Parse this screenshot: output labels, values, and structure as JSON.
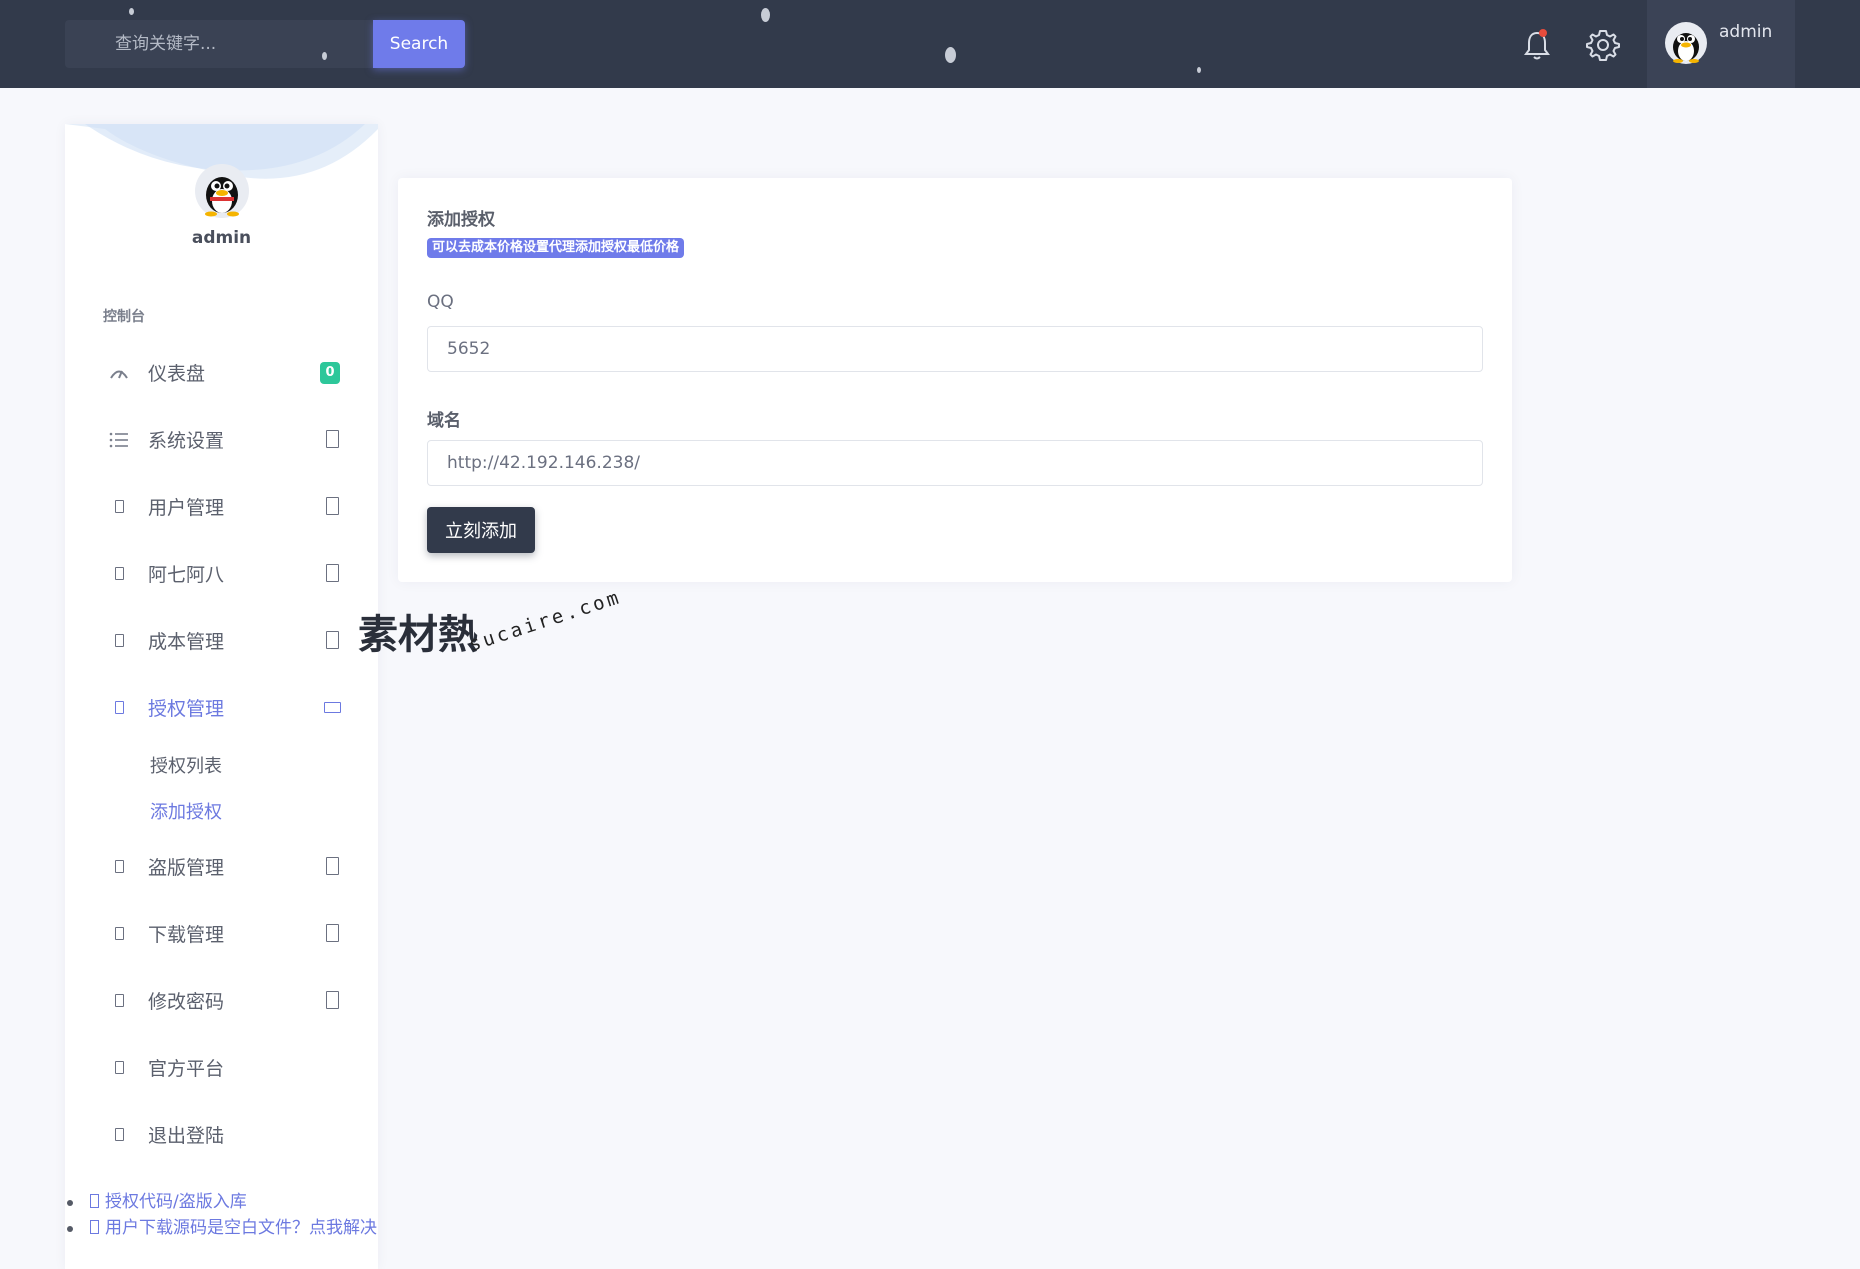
{
  "header": {
    "search_placeholder": "查询关键字...",
    "search_button": "Search",
    "user_name": "admin",
    "notification_dot_color": "#e74c3c"
  },
  "sidebar": {
    "user_name": "admin",
    "section_title": "控制台",
    "items": [
      {
        "label": "仪表盘",
        "icon": "dashboard-icon",
        "badge": "0"
      },
      {
        "label": "系统设置",
        "icon": "list-icon"
      },
      {
        "label": "用户管理",
        "icon": "box-icon"
      },
      {
        "label": "阿七阿八",
        "icon": "box-icon"
      },
      {
        "label": "成本管理",
        "icon": "box-icon"
      },
      {
        "label": "授权管理",
        "icon": "box-icon",
        "active": true
      },
      {
        "label": "盗版管理",
        "icon": "box-icon"
      },
      {
        "label": "下载管理",
        "icon": "box-icon"
      },
      {
        "label": "修改密码",
        "icon": "box-icon"
      },
      {
        "label": "官方平台",
        "icon": "box-icon"
      },
      {
        "label": "退出登陆",
        "icon": "box-icon"
      }
    ],
    "sub_items": [
      {
        "label": "授权列表"
      },
      {
        "label": "添加授权",
        "active": true
      }
    ],
    "footer_links": [
      "授权代码/盗版入库",
      "用户下载源码是空白文件？点我解决"
    ]
  },
  "form": {
    "title": "添加授权",
    "note": "可以去成本价格设置代理添加授权最低价格",
    "qq_label": "QQ",
    "qq_value": "5652",
    "domain_label": "域名",
    "domain_value": "http://42.192.146.238/",
    "submit_label": "立刻添加"
  },
  "watermark": {
    "cn": "素材熱",
    "en": "sucaire.com"
  },
  "colors": {
    "topbar": "#323a4b",
    "accent": "#6f7bea",
    "badge": "#2dc79a",
    "page_bg": "#f7f8fc"
  }
}
